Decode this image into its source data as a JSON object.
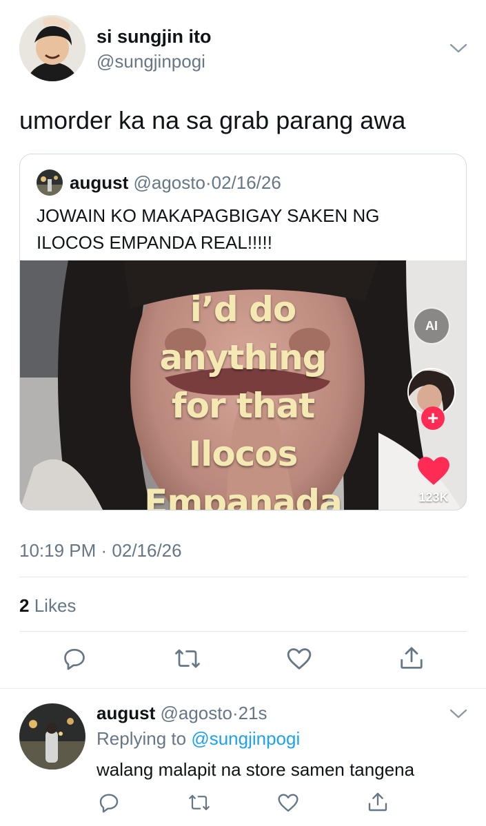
{
  "tweet": {
    "display_name": "si sungjin ito",
    "handle": "@sungjinpogi",
    "text": "umorder ka na sa grab parang awa",
    "timestamp": "10:19 PM · 02/16/26",
    "likes_count": "2",
    "likes_label": "Likes"
  },
  "quoted": {
    "display_name": "august",
    "handle": "@agosto",
    "separator": "·",
    "date": "02/16/26",
    "text_line1": "JOWAIN KO MAKAPAGBIGAY SAKEN NG",
    "text_line2": "ILOCOS EMPANDA REAL!!!!!",
    "media": {
      "caption_lines": [
        "i’d do",
        "anything",
        "for that",
        "Ilocos",
        "Empanada"
      ],
      "ai_badge": "AI",
      "like_count": "123K",
      "follow_symbol": "+"
    }
  },
  "reply": {
    "display_name": "august",
    "handle": "@agosto",
    "separator": "·",
    "time": "21s",
    "replying_prefix": "Replying to",
    "replying_handle": "@sungjinpogi",
    "text": "walang malapit na store samen tangena"
  },
  "icons": {
    "reply": "reply-icon",
    "retweet": "retweet-icon",
    "like": "like-icon",
    "share": "share-icon",
    "more": "chevron-down-icon"
  },
  "colors": {
    "text": "#0f1419",
    "secondary": "#657786",
    "link": "#1da1f2",
    "divider": "#e1e8ed",
    "tiktok_heart": "#fe2c55"
  }
}
